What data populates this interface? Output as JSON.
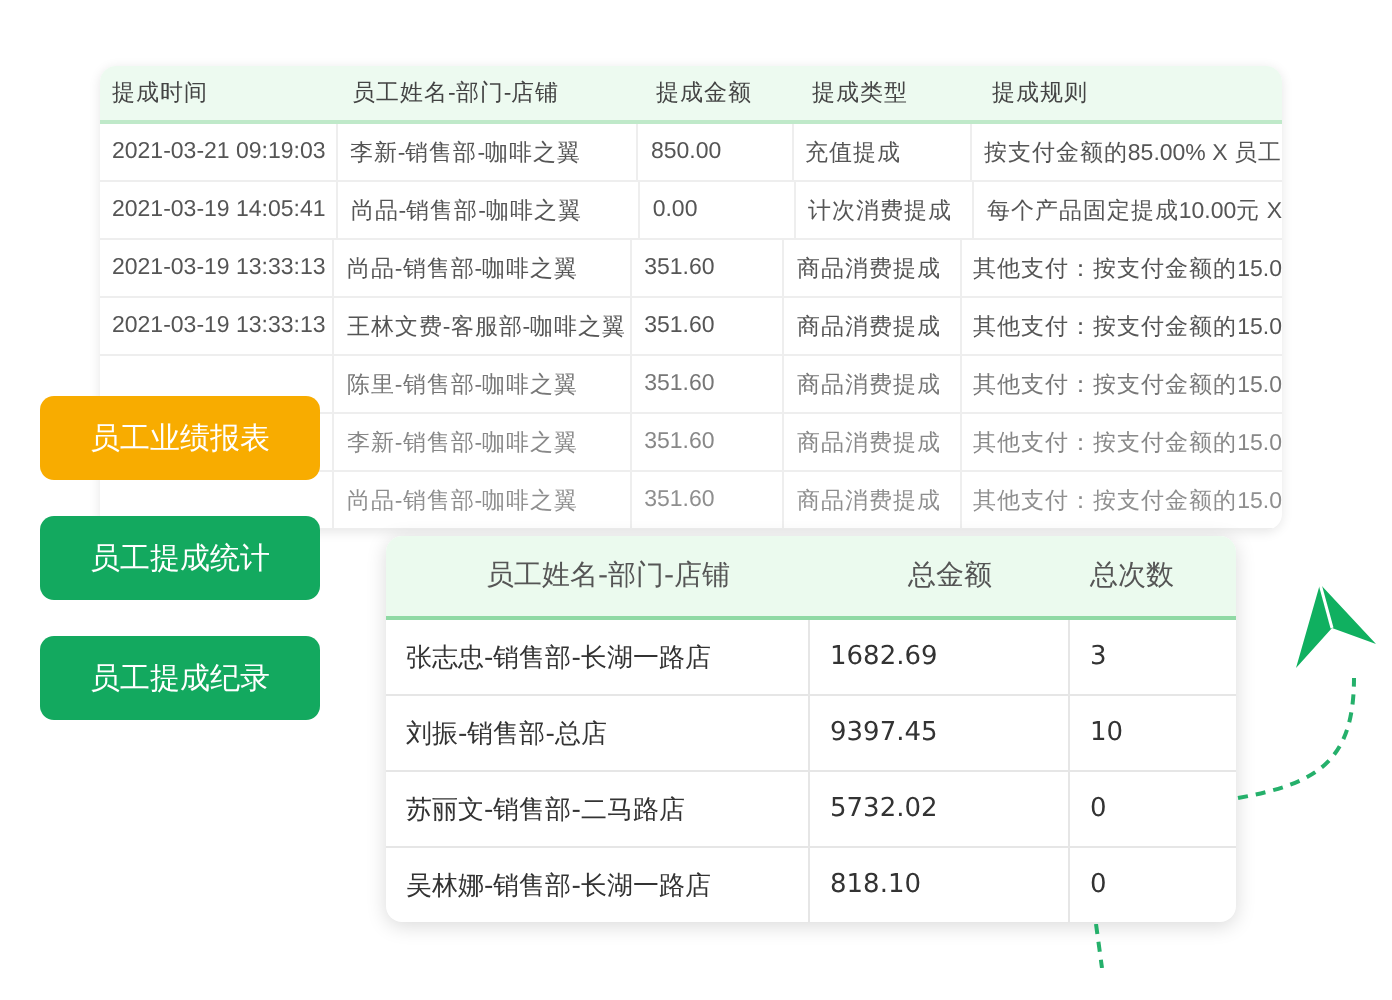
{
  "records_table": {
    "columns": [
      "提成时间",
      "员工姓名-部门-店铺",
      "提成金额",
      "提成类型",
      "提成规则"
    ],
    "rows": [
      {
        "time": "2021-03-21 09:19:03",
        "name": "李新-销售部-咖啡之翼",
        "amount": "850.00",
        "type": "充值提成",
        "rule": "按支付金额的85.00% X 员工"
      },
      {
        "time": "2021-03-19 14:05:41",
        "name": "尚品-销售部-咖啡之翼",
        "amount": "0.00",
        "type": "计次消费提成",
        "rule": "每个产品固定提成10.00元 X"
      },
      {
        "time": "2021-03-19 13:33:13",
        "name": "尚品-销售部-咖啡之翼",
        "amount": "351.60",
        "type": "商品消费提成",
        "rule": "其他支付：按支付金额的15.0"
      },
      {
        "time": "2021-03-19 13:33:13",
        "name": "王林文费-客服部-咖啡之翼",
        "amount": "351.60",
        "type": "商品消费提成",
        "rule": "其他支付：按支付金额的15.0"
      },
      {
        "name": "陈里-销售部-咖啡之翼",
        "amount": "351.60",
        "type": "商品消费提成",
        "rule": "其他支付：按支付金额的15.0"
      },
      {
        "name": "李新-销售部-咖啡之翼",
        "amount": "351.60",
        "type": "商品消费提成",
        "rule": "其他支付：按支付金额的15.0"
      },
      {
        "name": "尚品-销售部-咖啡之翼",
        "amount": "351.60",
        "type": "商品消费提成",
        "rule": "其他支付：按支付金额的15.0"
      }
    ]
  },
  "menu": [
    {
      "label": "员工业绩报表",
      "selected": true
    },
    {
      "label": "员工提成统计",
      "selected": false
    },
    {
      "label": "员工提成纪录",
      "selected": false
    }
  ],
  "summary_table": {
    "columns": [
      "员工姓名-部门-店铺",
      "总金额",
      "总次数"
    ],
    "rows": [
      {
        "name": "张志忠-销售部-长湖一路店",
        "total": "1682.69",
        "count": "3"
      },
      {
        "name": "刘振-销售部-总店",
        "total": "9397.45",
        "count": "10"
      },
      {
        "name": "苏丽文-销售部-二马路店",
        "total": "5732.02",
        "count": "0"
      },
      {
        "name": "吴林娜-销售部-长湖一路店",
        "total": "818.10",
        "count": "0"
      }
    ]
  }
}
